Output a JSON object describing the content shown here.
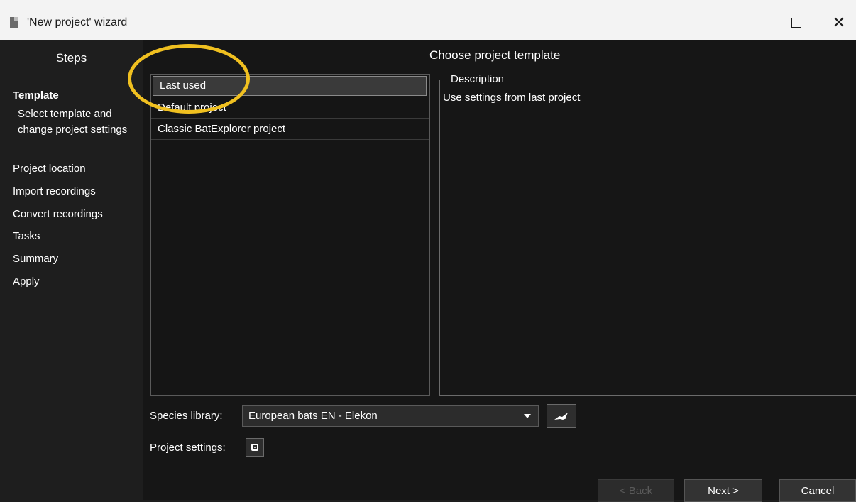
{
  "window": {
    "title": "'New project' wizard"
  },
  "sidebar": {
    "title": "Steps",
    "steps": [
      {
        "label": "Template",
        "description": "Select template and change project settings"
      },
      {
        "label": "Project location"
      },
      {
        "label": "Import recordings"
      },
      {
        "label": "Convert recordings"
      },
      {
        "label": "Tasks"
      },
      {
        "label": "Summary"
      },
      {
        "label": "Apply"
      }
    ]
  },
  "main": {
    "heading": "Choose project template",
    "templates": [
      "Last used",
      "Default project",
      "Classic BatExplorer project"
    ],
    "selected_template": "Last used",
    "description_title": "Description",
    "description_text": "Use settings from last project",
    "species_library_label": "Species library:",
    "species_library_value": "European bats EN - Elekon",
    "project_settings_label": "Project settings:"
  },
  "footer": {
    "back": "< Back",
    "next": "Next >",
    "cancel": "Cancel"
  },
  "colors": {
    "highlight": "#f0c020",
    "background": "#161616"
  }
}
